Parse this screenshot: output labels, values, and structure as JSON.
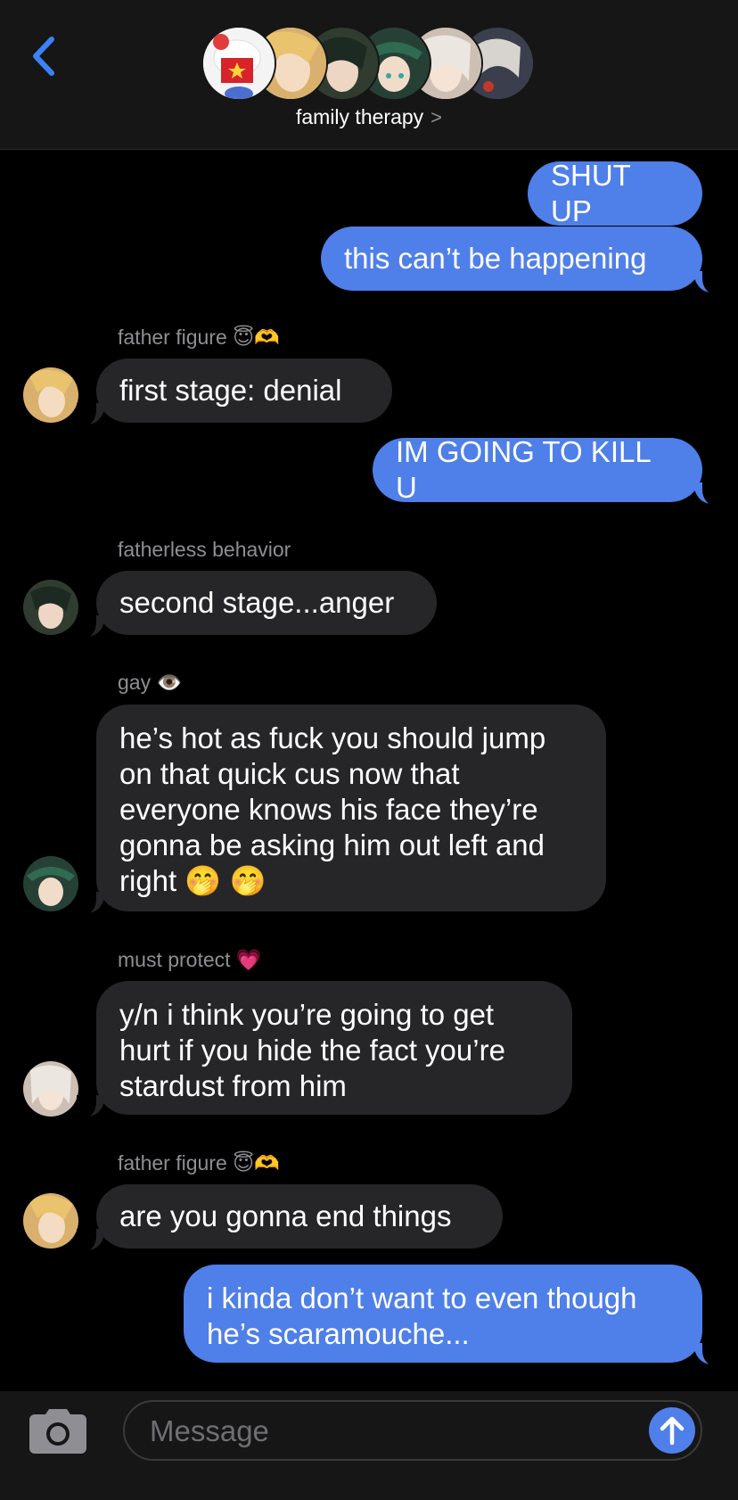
{
  "header": {
    "group_name": "family therapy",
    "chevron": ">"
  },
  "messages": [
    {
      "text": "SHUT UP"
    },
    {
      "text": "this can’t be happening"
    },
    {
      "sender": "father figure 😇🫶",
      "text": "first stage: denial"
    },
    {
      "text": "IM GOING TO KILL U"
    },
    {
      "sender": "fatherless behavior",
      "text": "second stage...anger"
    },
    {
      "sender": "gay 👁️",
      "lines": [
        "he’s hot as fuck you should jump",
        "on that quick cus now that",
        "everyone knows his face they’re",
        "gonna be asking him out left and",
        "right 🤭 🤭"
      ]
    },
    {
      "sender": "must protect 💗",
      "lines": [
        "y/n i think you’re going to get",
        "hurt if you hide the fact you’re",
        "stardust from him"
      ]
    },
    {
      "sender": "father figure 😇🫶",
      "text": "are you gonna end things"
    },
    {
      "lines": [
        "i kinda don’t want to even though",
        "he’s scaramouche..."
      ]
    }
  ],
  "composer": {
    "placeholder": "Message"
  },
  "colors": {
    "outgoing_bubble": "#4f7fe8",
    "incoming_bubble": "#262628",
    "accent": "#3b82f6"
  },
  "icons": [
    "back-chevron-icon",
    "camera-icon",
    "send-arrow-icon"
  ]
}
